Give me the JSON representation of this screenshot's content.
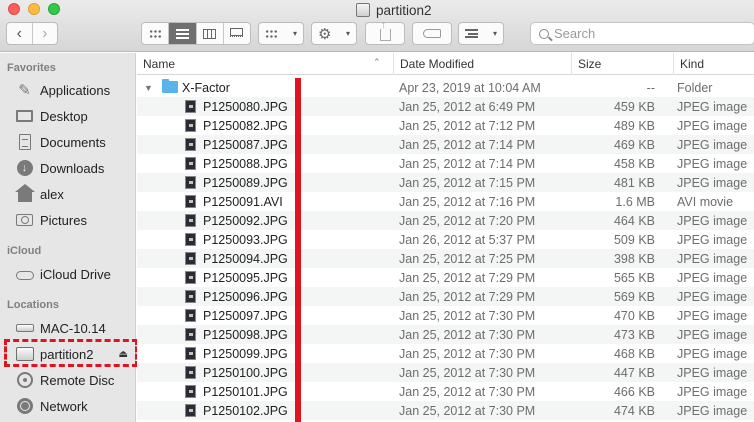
{
  "window": {
    "title": "partition2"
  },
  "toolbar": {
    "back_glyph": "‹",
    "forward_glyph": "›",
    "action_glyph": "⚙",
    "caret_glyph": "▾",
    "search_placeholder": "Search"
  },
  "sidebar": {
    "sections": [
      {
        "label": "Favorites"
      },
      {
        "label": "iCloud"
      },
      {
        "label": "Locations"
      }
    ],
    "favorites": [
      {
        "label": "Applications",
        "icon": "applications-icon"
      },
      {
        "label": "Desktop",
        "icon": "desktop-icon"
      },
      {
        "label": "Documents",
        "icon": "documents-icon"
      },
      {
        "label": "Downloads",
        "icon": "downloads-icon"
      },
      {
        "label": "alex",
        "icon": "home-icon"
      },
      {
        "label": "Pictures",
        "icon": "pictures-icon"
      }
    ],
    "icloud": [
      {
        "label": "iCloud Drive",
        "icon": "cloud-icon"
      }
    ],
    "locations": [
      {
        "label": "MAC-10.14",
        "icon": "drive-icon"
      },
      {
        "label": "partition2",
        "icon": "external-drive-icon",
        "eject": "⏏"
      },
      {
        "label": "Remote Disc",
        "icon": "disc-icon"
      },
      {
        "label": "Network",
        "icon": "network-icon"
      }
    ]
  },
  "columns": {
    "name": "Name",
    "date": "Date Modified",
    "size": "Size",
    "kind": "Kind",
    "sort_glyph": "⌃"
  },
  "folder": {
    "name": "X-Factor",
    "date": "Apr 23, 2019 at 10:04 AM",
    "size": "--",
    "kind": "Folder",
    "disclosure": "▼"
  },
  "files": [
    {
      "name": "P1250080.JPG",
      "date": "Jan 25, 2012 at 6:49 PM",
      "size": "459 KB",
      "kind": "JPEG image"
    },
    {
      "name": "P1250082.JPG",
      "date": "Jan 25, 2012 at 7:12 PM",
      "size": "489 KB",
      "kind": "JPEG image"
    },
    {
      "name": "P1250087.JPG",
      "date": "Jan 25, 2012 at 7:14 PM",
      "size": "469 KB",
      "kind": "JPEG image"
    },
    {
      "name": "P1250088.JPG",
      "date": "Jan 25, 2012 at 7:14 PM",
      "size": "458 KB",
      "kind": "JPEG image"
    },
    {
      "name": "P1250089.JPG",
      "date": "Jan 25, 2012 at 7:15 PM",
      "size": "481 KB",
      "kind": "JPEG image"
    },
    {
      "name": "P1250091.AVI",
      "date": "Jan 25, 2012 at 7:16 PM",
      "size": "1.6 MB",
      "kind": "AVI movie"
    },
    {
      "name": "P1250092.JPG",
      "date": "Jan 25, 2012 at 7:20 PM",
      "size": "464 KB",
      "kind": "JPEG image"
    },
    {
      "name": "P1250093.JPG",
      "date": "Jan 26, 2012 at 5:37 PM",
      "size": "509 KB",
      "kind": "JPEG image"
    },
    {
      "name": "P1250094.JPG",
      "date": "Jan 25, 2012 at 7:25 PM",
      "size": "398 KB",
      "kind": "JPEG image"
    },
    {
      "name": "P1250095.JPG",
      "date": "Jan 25, 2012 at 7:29 PM",
      "size": "565 KB",
      "kind": "JPEG image"
    },
    {
      "name": "P1250096.JPG",
      "date": "Jan 25, 2012 at 7:29 PM",
      "size": "569 KB",
      "kind": "JPEG image"
    },
    {
      "name": "P1250097.JPG",
      "date": "Jan 25, 2012 at 7:30 PM",
      "size": "470 KB",
      "kind": "JPEG image"
    },
    {
      "name": "P1250098.JPG",
      "date": "Jan 25, 2012 at 7:30 PM",
      "size": "473 KB",
      "kind": "JPEG image"
    },
    {
      "name": "P1250099.JPG",
      "date": "Jan 25, 2012 at 7:30 PM",
      "size": "468 KB",
      "kind": "JPEG image"
    },
    {
      "name": "P1250100.JPG",
      "date": "Jan 25, 2012 at 7:30 PM",
      "size": "447 KB",
      "kind": "JPEG image"
    },
    {
      "name": "P1250101.JPG",
      "date": "Jan 25, 2012 at 7:30 PM",
      "size": "466 KB",
      "kind": "JPEG image"
    },
    {
      "name": "P1250102.JPG",
      "date": "Jan 25, 2012 at 7:30 PM",
      "size": "474 KB",
      "kind": "JPEG image"
    }
  ],
  "colors": {
    "annotation_red": "#e0141f",
    "folder_blue": "#5ab4ea"
  }
}
